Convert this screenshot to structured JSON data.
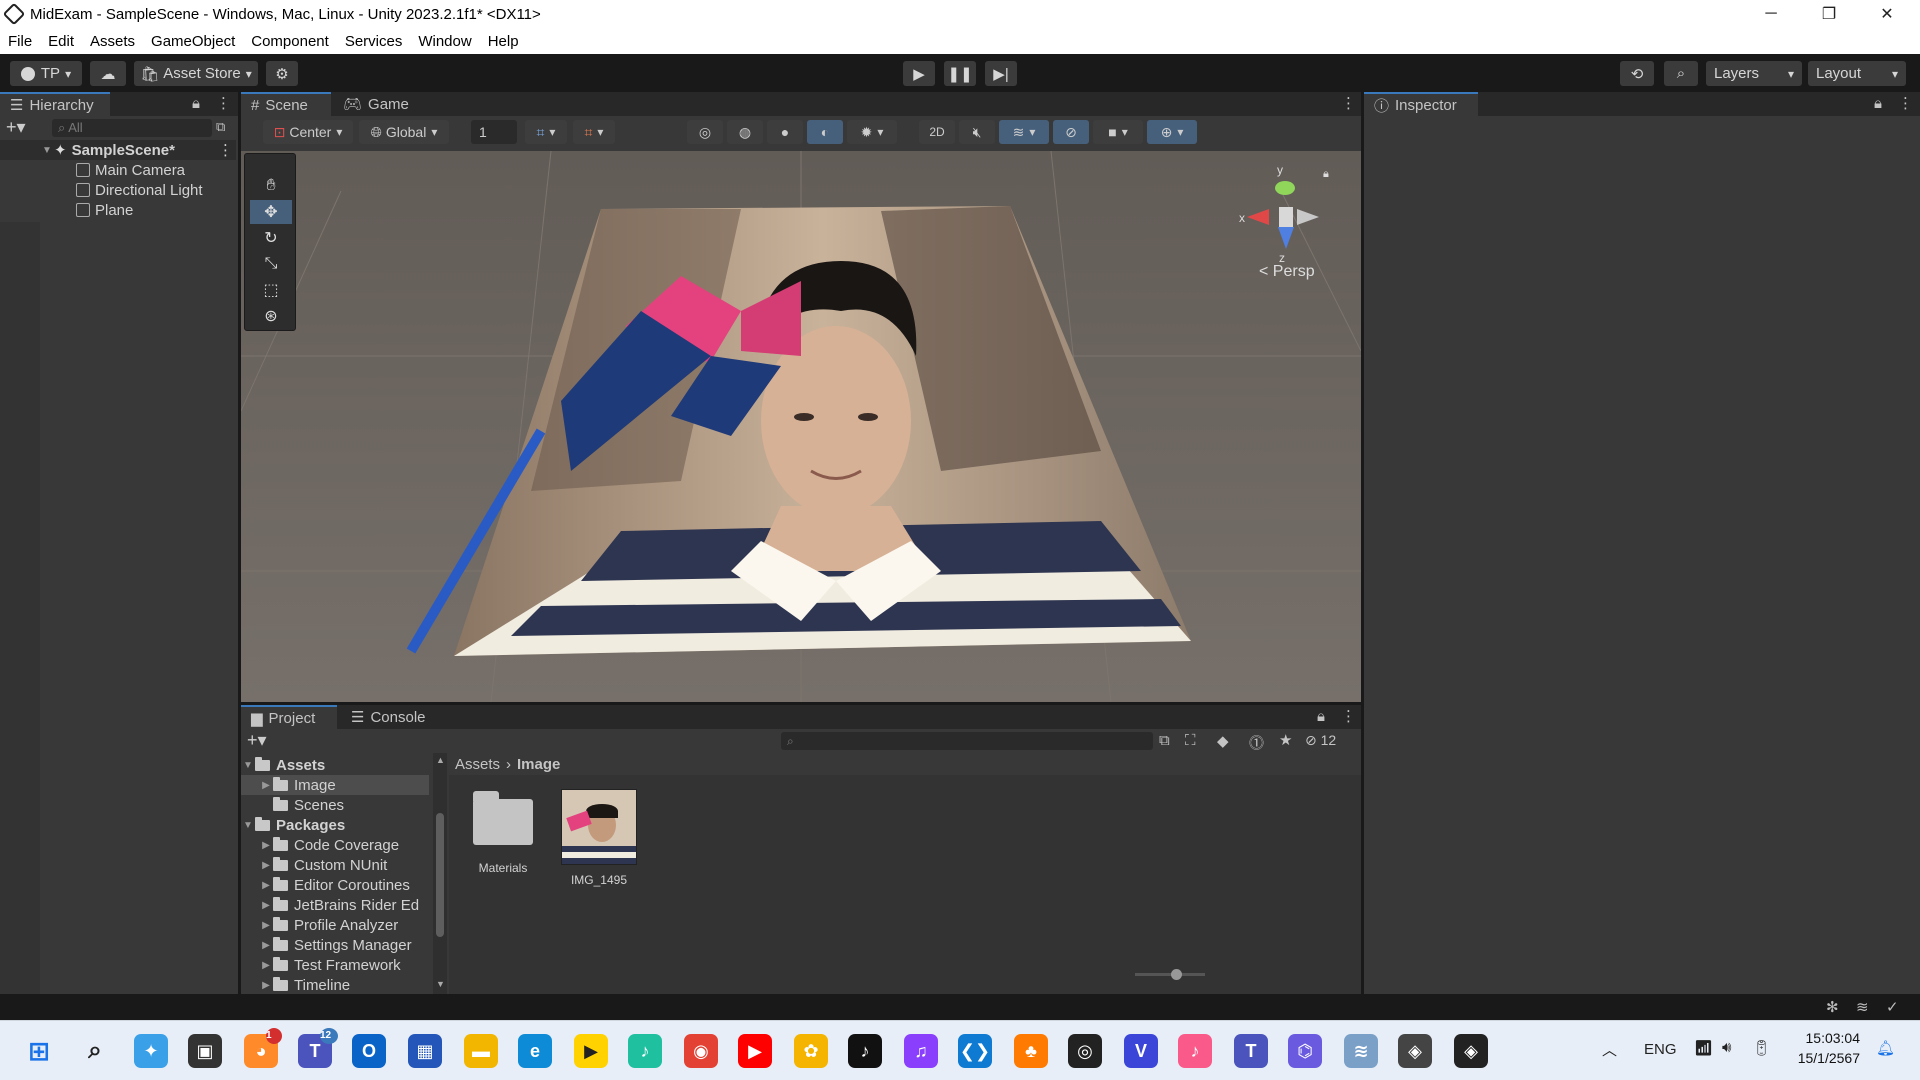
{
  "window": {
    "title": "MidExam - SampleScene - Windows, Mac, Linux - Unity 2023.2.1f1* <DX11>",
    "minimize": "─",
    "maximize": "❐",
    "close": "✕"
  },
  "menu": [
    "File",
    "Edit",
    "Assets",
    "GameObject",
    "Component",
    "Services",
    "Window",
    "Help"
  ],
  "toolbar": {
    "account": "TP",
    "asset_store": "Asset Store",
    "layers": "Layers",
    "layout": "Layout"
  },
  "hierarchy": {
    "tab": "Hierarchy",
    "search_placeholder": "All",
    "scene": "SampleScene*",
    "items": [
      "Main Camera",
      "Directional Light",
      "Plane"
    ]
  },
  "scene_tabs": {
    "scene": "Scene",
    "game": "Game"
  },
  "scene_toolbar": {
    "pivot": "Center",
    "space": "Global",
    "grid_size": "1",
    "mode_2d": "2D"
  },
  "gizmo": {
    "y": "y",
    "x": "x",
    "z": "z",
    "persp": "< Persp"
  },
  "inspector": {
    "tab": "Inspector"
  },
  "project": {
    "tab_project": "Project",
    "tab_console": "Console",
    "hidden_count": "12",
    "tree": {
      "assets": "Assets",
      "assets_children": [
        "Image",
        "Scenes"
      ],
      "packages": "Packages",
      "packages_children": [
        "Code Coverage",
        "Custom NUnit",
        "Editor Coroutines",
        "JetBrains Rider Ed",
        "Profile Analyzer",
        "Settings Manager",
        "Test Framework",
        "Timeline"
      ]
    },
    "breadcrumb": [
      "Assets",
      "Image"
    ],
    "files": [
      {
        "name": "Materials",
        "type": "folder"
      },
      {
        "name": "IMG_1495",
        "type": "image"
      }
    ]
  },
  "taskbar": {
    "language": "ENG",
    "time": "15:03:04",
    "date": "15/1/2567",
    "badge_a": "1",
    "badge_b": "12"
  }
}
